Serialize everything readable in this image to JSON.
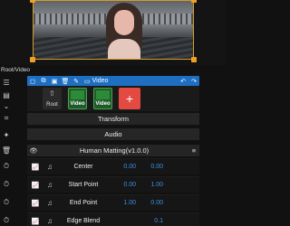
{
  "breadcrumb": "Root/Video",
  "toolbar": {
    "video_label": "Video"
  },
  "clips": {
    "root": "Root",
    "video1": "Video",
    "video2": "Video",
    "add": "+"
  },
  "sections": {
    "transform": "Transform",
    "audio": "Audio"
  },
  "effect": {
    "name": "Human Matting(v1.0.0)"
  },
  "params": [
    {
      "label": "Center",
      "v1": "0.00",
      "v2": "0.00"
    },
    {
      "label": "Start Point",
      "v1": "0.00",
      "v2": "1.00"
    },
    {
      "label": "End Point",
      "v1": "1.00",
      "v2": "0.00"
    },
    {
      "label": "Edge Blend",
      "v1": "",
      "v2": "0.1"
    }
  ],
  "colors": {
    "accent_blue": "#1e6fc2",
    "value_blue": "#3b8fe0",
    "handle_orange": "#f0a020",
    "add_red": "#e24a42",
    "clip_green": "#1d5b2a"
  }
}
